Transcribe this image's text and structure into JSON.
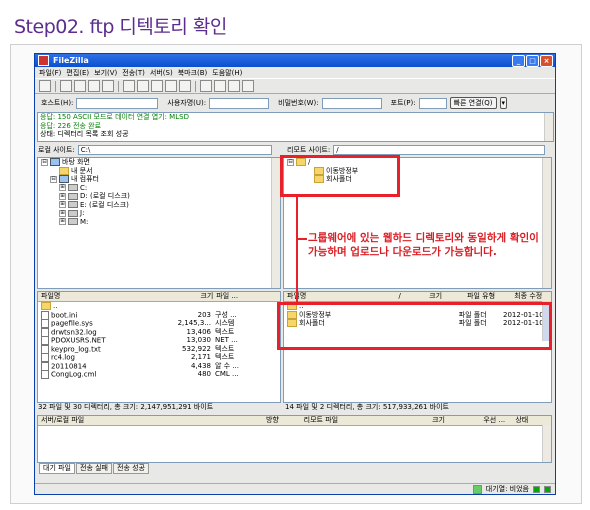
{
  "heading": "Step02. ftp 디텍토리 확인",
  "app": {
    "title": "FileZilla",
    "icon": "filezilla-icon"
  },
  "window_buttons": {
    "minimize": "_",
    "maximize": "□",
    "close": "×"
  },
  "menu": [
    "파일(F)",
    "편집(E)",
    "보기(V)",
    "전송(T)",
    "서버(S)",
    "북마크(B)",
    "도움말(H)"
  ],
  "quickconnect": {
    "host_label": "호스트(H):",
    "user_label": "사용자명(U):",
    "pass_label": "비밀번호(W):",
    "port_label": "포트(P):",
    "button": "빠른 연결(Q)",
    "dropdown": "▾"
  },
  "log": [
    {
      "label": "응답:",
      "text": "150 ASCII 모드로 데이터 연결 엽기: MLSD",
      "cls": "ok"
    },
    {
      "label": "응답:",
      "text": "226 전송 완료",
      "cls": "ok"
    },
    {
      "label": "상태:",
      "text": "디렉터리 목록 조회 성공",
      "cls": ""
    }
  ],
  "local": {
    "site_label": "로컬 사이트:",
    "path": "C:\\",
    "tree": [
      {
        "label": "바탕 화면",
        "indent": 0,
        "exp": "⊟",
        "icon": "desktop"
      },
      {
        "label": "내 문서",
        "indent": 1,
        "exp": "",
        "icon": "folder"
      },
      {
        "label": "내 컴퓨터",
        "indent": 1,
        "exp": "⊟",
        "icon": "pc"
      },
      {
        "label": "C:",
        "indent": 2,
        "exp": "⊞",
        "icon": "drive"
      },
      {
        "label": "D: (로컬 디스크)",
        "indent": 2,
        "exp": "⊞",
        "icon": "drive"
      },
      {
        "label": "E: (로컬 디스크)",
        "indent": 2,
        "exp": "⊞",
        "icon": "drive"
      },
      {
        "label": "J:",
        "indent": 2,
        "exp": "⊞",
        "icon": "drive"
      },
      {
        "label": "M:",
        "indent": 2,
        "exp": "⊞",
        "icon": "drive"
      }
    ],
    "columns": [
      "파일명",
      "크기",
      "파일 ..."
    ],
    "files": [
      {
        "name": "..",
        "size": "",
        "type": ""
      },
      {
        "name": "boot.ini",
        "size": "203",
        "type": "구성 ..."
      },
      {
        "name": "pagefile.sys",
        "size": "2,145,3...",
        "type": "시스템"
      },
      {
        "name": "drwtsn32.log",
        "size": "13,406",
        "type": "텍스트"
      },
      {
        "name": "PDOXUSRS.NET",
        "size": "13,030",
        "type": "NET ..."
      },
      {
        "name": "keypro_log.txt",
        "size": "532,922",
        "type": "텍스트"
      },
      {
        "name": "rc4.log",
        "size": "2,171",
        "type": "텍스트"
      },
      {
        "name": "20110814",
        "size": "4,438",
        "type": "알 수 ..."
      },
      {
        "name": "CongLog.cml",
        "size": "480",
        "type": "CML ..."
      }
    ],
    "summary": "32 파일 및 30 디렉터리, 총 크기: 2,147,951,291 바이트"
  },
  "remote": {
    "site_label": "리모트 사이트:",
    "path": "/",
    "tree": [
      {
        "label": "/",
        "indent": 0,
        "exp": "⊟",
        "icon": "folder"
      },
      {
        "label": "이동방정부",
        "indent": 2,
        "exp": "",
        "icon": "folder"
      },
      {
        "label": "회사폴더",
        "indent": 2,
        "exp": "",
        "icon": "folder"
      }
    ],
    "columns": [
      "파일명",
      "/",
      "크기",
      "파일 유형",
      "최종 수정"
    ],
    "files": [
      {
        "name": "..",
        "size": "",
        "type": "",
        "date": ""
      },
      {
        "name": "이동방정부",
        "size": "",
        "type": "파일 폴더",
        "date": "2012-01-10 오후"
      },
      {
        "name": "회사폴더",
        "size": "",
        "type": "파일 폴더",
        "date": "2012-01-10 오후"
      }
    ],
    "summary": "14 파일 및 2 디렉터리, 총 크기: 517,933,261 바이트"
  },
  "queue": {
    "columns": [
      "서버/로컬 파일",
      "방향",
      "리모트 파일",
      "크기",
      "우선 ...",
      "상태"
    ],
    "tabs": [
      "대기 파일",
      "전송 실패",
      "전송 성공"
    ]
  },
  "statusbar": {
    "queue": "대기열: 비었음"
  },
  "callout": {
    "line1": "그룹웨어에 있는 웹하드 디렉토리와 동일하게 확인이",
    "line2": "가능하며 업로드나 다운로드가 가능합니다."
  },
  "colors": {
    "highlight": "#e8202a",
    "heading": "#5b2d8e",
    "titlebar": "#0a4fd0"
  }
}
